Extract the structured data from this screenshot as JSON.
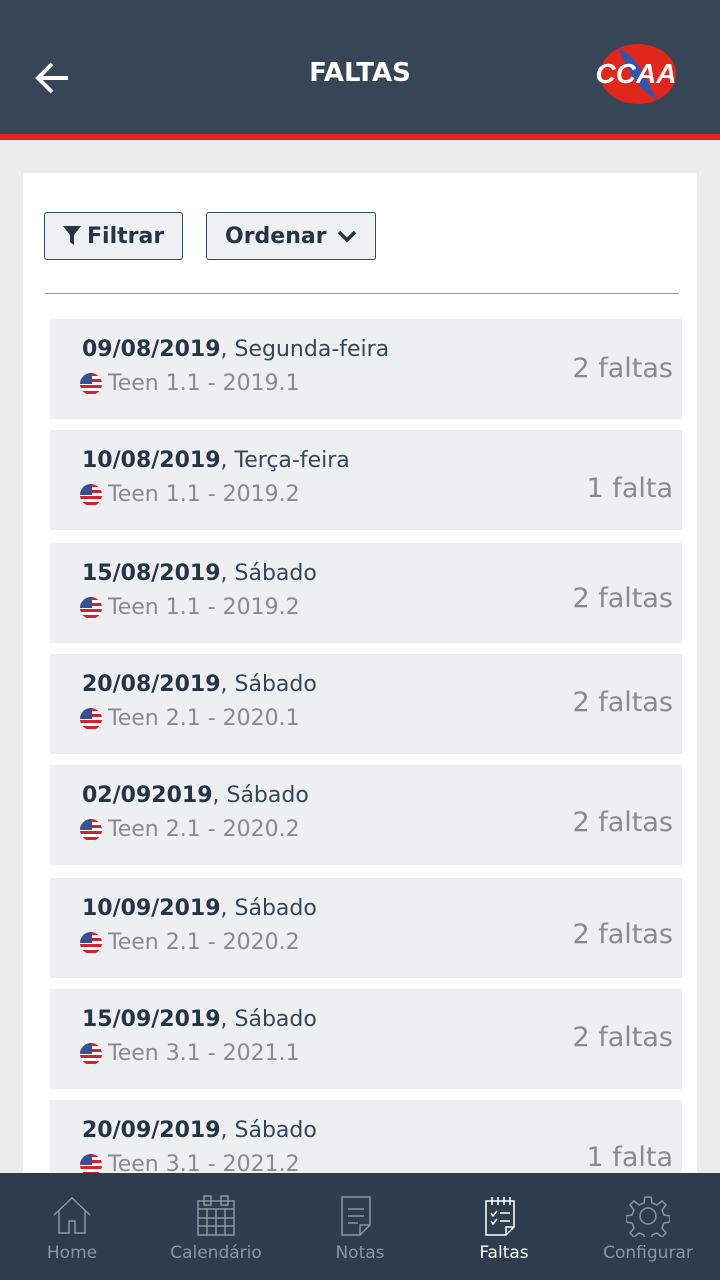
{
  "header": {
    "title": "FALTAS",
    "logo_text": "CCAA"
  },
  "toolbar": {
    "filter_label": "Filtrar",
    "sort_label": "Ordenar"
  },
  "items": [
    {
      "date": "09/08/2019",
      "weekday": ", Segunda-feira",
      "course": "Teen 1.1 - 2019.1",
      "count": "2 faltas"
    },
    {
      "date": "10/08/2019",
      "weekday": ", Terça-feira",
      "course": "Teen 1.1 - 2019.2",
      "count": "1 falta"
    },
    {
      "date": "15/08/2019",
      "weekday": ", Sábado",
      "course": "Teen 1.1 - 2019.2",
      "count": "2 faltas"
    },
    {
      "date": "20/08/2019",
      "weekday": ", Sábado",
      "course": "Teen 2.1 - 2020.1",
      "count": "2 faltas"
    },
    {
      "date": "02/092019",
      "weekday": ", Sábado",
      "course": "Teen 2.1 - 2020.2",
      "count": "2 faltas"
    },
    {
      "date": "10/09/2019",
      "weekday": ", Sábado",
      "course": "Teen 2.1 - 2020.2",
      "count": "2 faltas"
    },
    {
      "date": "15/09/2019",
      "weekday": ", Sábado",
      "course": "Teen 3.1 - 2021.1",
      "count": "2 faltas"
    },
    {
      "date": "20/09/2019",
      "weekday": ", Sábado",
      "course": "Teen 3.1 - 2021.2",
      "count": "1 falta"
    }
  ],
  "nav": [
    {
      "label": "Home"
    },
    {
      "label": "Calendário"
    },
    {
      "label": "Notas"
    },
    {
      "label": "Faltas"
    },
    {
      "label": "Configurar"
    }
  ],
  "colors": {
    "header": "#374656",
    "accent": "#e1261c",
    "nav": "#2e3d4e"
  }
}
